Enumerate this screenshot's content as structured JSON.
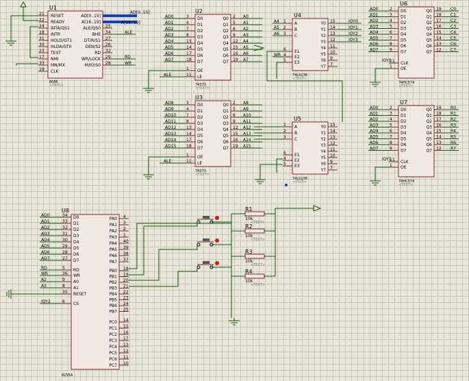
{
  "placeholder_text": "<TEXT>",
  "colors": {
    "wire": "#0a5a0a",
    "bus": "#1440c8",
    "chip": "#7a2a2a",
    "chip_fill": "#f1e7e3",
    "grid": "#c9c7b8"
  },
  "U1": {
    "ref": "U1",
    "type": "8086",
    "left_pins": [
      {
        "n": "21",
        "l": "RESET"
      },
      {
        "n": "22",
        "l": "READY"
      },
      {
        "n": "24",
        "l": "INTA/QS1"
      },
      {
        "n": "18",
        "l": "INTR"
      },
      {
        "n": "31",
        "l": "HOLD/GT1"
      },
      {
        "n": "30",
        "l": "HLDA/GT0"
      },
      {
        "n": "23",
        "l": "TEST"
      },
      {
        "n": "17",
        "l": "NMI"
      },
      {
        "n": "33",
        "l": "MN/MX"
      },
      {
        "n": "19",
        "l": "CLK"
      }
    ],
    "right_pins": [
      {
        "n": "",
        "l": "AD[0..15]"
      },
      {
        "n": "",
        "l": "A[16..19]"
      },
      {
        "n": "25",
        "l": "ALE/QS0"
      },
      {
        "n": "34",
        "l": "BHE"
      },
      {
        "n": "27",
        "l": "DT/R/S1"
      },
      {
        "n": "26",
        "l": "DEN/S2"
      },
      {
        "n": "32",
        "l": "RD"
      },
      {
        "n": "29",
        "l": "WR/LOCK"
      },
      {
        "n": "28",
        "l": "M/IO/S0"
      }
    ],
    "nets": [
      "AD[0..15]",
      "A[16..19]",
      "ALE",
      "RD",
      "WR"
    ]
  },
  "U2": {
    "ref": "U2",
    "type": "74373",
    "in_labels": [
      "D0",
      "D1",
      "D2",
      "D3",
      "D4",
      "D5",
      "D6",
      "D7"
    ],
    "in_pins": [
      "3",
      "4",
      "7",
      "8",
      "13",
      "14",
      "17",
      "18"
    ],
    "out_labels": [
      "Q0",
      "Q1",
      "Q2",
      "Q3",
      "Q4",
      "Q5",
      "Q6",
      "Q7"
    ],
    "out_pins": [
      "2",
      "5",
      "6",
      "9",
      "12",
      "15",
      "16",
      "19"
    ],
    "in_nets": [
      "AD0",
      "AD1",
      "AD2",
      "AD3",
      "AD4",
      "AD5",
      "AD6",
      "AD7"
    ],
    "out_nets": [
      "A0",
      "A1",
      "A2",
      "A3",
      "A4",
      "A5",
      "A6",
      "A7"
    ],
    "ctrl": [
      {
        "n": "1",
        "l": "OE"
      },
      {
        "n": "11",
        "l": "LE"
      }
    ],
    "le_net": "ALE"
  },
  "U3": {
    "ref": "U3",
    "type": "74373",
    "in_labels": [
      "D0",
      "D1",
      "D2",
      "D3",
      "D4",
      "D5",
      "D6",
      "D7"
    ],
    "in_pins": [
      "3",
      "4",
      "7",
      "8",
      "13",
      "14",
      "17",
      "18"
    ],
    "out_labels": [
      "Q0",
      "Q1",
      "Q2",
      "Q3",
      "Q4",
      "Q5",
      "Q6",
      "Q7"
    ],
    "out_pins": [
      "2",
      "5",
      "6",
      "9",
      "12",
      "15",
      "16",
      "19"
    ],
    "in_nets": [
      "AD8",
      "AD9",
      "AD10",
      "AD11",
      "AD12",
      "AD13",
      "AD14",
      "AD15"
    ],
    "out_nets": [
      "A8",
      "A9",
      "A10",
      "A11",
      "A12",
      "A13",
      "A14",
      "A15"
    ],
    "ctrl": [
      {
        "n": "1",
        "l": "OE"
      },
      {
        "n": "11",
        "l": "LE"
      }
    ],
    "le_net": "ALE"
  },
  "U4": {
    "ref": "U4",
    "type": "74LS138",
    "in_labels": [
      "A",
      "B",
      "C"
    ],
    "in_pins": [
      "1",
      "2",
      "3"
    ],
    "in_nets": [
      "A4",
      "A5",
      "A6"
    ],
    "en_labels": [
      "E1",
      "E2",
      "E3"
    ],
    "en_pins": [
      "6",
      "4",
      "5"
    ],
    "en_nets": [
      "",
      "WR",
      ""
    ],
    "out_labels": [
      "Y0",
      "Y1",
      "Y2",
      "Y3",
      "Y4",
      "Y5",
      "Y6",
      "Y7"
    ],
    "out_pins": [
      "15",
      "14",
      "13",
      "12",
      "11",
      "10",
      "9",
      "7"
    ],
    "out_nets": [
      "IOY0",
      "IOY1",
      "IOY2",
      "IOY3"
    ]
  },
  "U5": {
    "ref": "U5",
    "type": "74LS138",
    "in_labels": [
      "A",
      "B",
      "C"
    ],
    "in_pins": [
      "1",
      "2",
      "3"
    ],
    "in_nets": [
      "A12",
      "A13",
      "A14"
    ],
    "en_labels": [
      "E1",
      "E2",
      "E3"
    ],
    "en_pins": [
      "6",
      "4",
      "5"
    ],
    "out_labels": [
      "Y0",
      "Y1",
      "Y2",
      "Y3",
      "Y4",
      "Y5",
      "Y6",
      "Y7"
    ],
    "out_pins": [
      "15",
      "14",
      "13",
      "12",
      "11",
      "10",
      "9",
      "7"
    ]
  },
  "U6": {
    "ref": "U6",
    "type": "74HC574",
    "in_labels": [
      "D0",
      "D1",
      "D2",
      "D3",
      "D4",
      "D5",
      "D6",
      "D7"
    ],
    "in_pins": [
      "2",
      "3",
      "4",
      "5",
      "6",
      "7",
      "8",
      "9"
    ],
    "out_labels": [
      "Q0",
      "Q1",
      "Q2",
      "Q3",
      "Q4",
      "Q5",
      "Q6",
      "Q7"
    ],
    "out_pins": [
      "19",
      "18",
      "17",
      "16",
      "15",
      "14",
      "13",
      "12"
    ],
    "in_nets": [
      "AD0",
      "AD1",
      "AD2",
      "AD3",
      "AD4",
      "AD5",
      "AD6",
      "AD7"
    ],
    "out_nets": [
      "C0",
      "C1",
      "C2",
      "C3",
      "C4",
      "C5",
      "C6",
      "C7"
    ],
    "ctrl": [
      {
        "n": "11",
        "l": "CLK"
      },
      {
        "n": "1",
        "l": "OE"
      }
    ],
    "clk_net": "IOY0"
  },
  "U7": {
    "ref": "U7",
    "type": "74HC574",
    "in_labels": [
      "D0",
      "D1",
      "D2",
      "D3",
      "D4",
      "D5",
      "D6",
      "D7"
    ],
    "in_pins": [
      "2",
      "3",
      "4",
      "5",
      "6",
      "7",
      "8",
      "9"
    ],
    "out_labels": [
      "Q0",
      "Q1",
      "Q2",
      "Q3",
      "Q4",
      "Q5",
      "Q6",
      "Q7"
    ],
    "out_pins": [
      "19",
      "18",
      "17",
      "16",
      "15",
      "14",
      "13",
      "12"
    ],
    "in_nets": [
      "AD0",
      "AD1",
      "AD2",
      "AD3",
      "AD4",
      "AD5",
      "AD6",
      "AD7"
    ],
    "out_nets": [
      "R0",
      "R1",
      "R2",
      "R3",
      "R4",
      "R5",
      "R6",
      "R7"
    ],
    "ctrl": [
      {
        "n": "11",
        "l": "CLK"
      },
      {
        "n": "1",
        "l": "OE"
      }
    ],
    "clk_net": "IOY1"
  },
  "U8": {
    "ref": "U8",
    "type": "8255A",
    "d_labels": [
      "D0",
      "D1",
      "D2",
      "D3",
      "D4",
      "D5",
      "D6",
      "D7"
    ],
    "d_pins": [
      "34",
      "33",
      "32",
      "31",
      "30",
      "29",
      "28",
      "27"
    ],
    "d_nets": [
      "AD0",
      "AD1",
      "AD2",
      "AD3",
      "AD4",
      "AD5",
      "AD6",
      "AD7"
    ],
    "ctl_labels": [
      "RD",
      "WR",
      "A0",
      "A1",
      "RESET",
      "CS"
    ],
    "ctl_pins": [
      "5",
      "36",
      "9",
      "8",
      "35",
      "6"
    ],
    "ctl_nets": [
      "RD",
      "WR",
      "A2",
      "A3",
      "",
      "IOY2"
    ],
    "pa_labels": [
      "PA0",
      "PA1",
      "PA2",
      "PA3",
      "PA4",
      "PA5",
      "PA6",
      "PA7"
    ],
    "pa_pins": [
      "4",
      "3",
      "2",
      "1",
      "40",
      "39",
      "38",
      "37"
    ],
    "pb_labels": [
      "PB0",
      "PB1",
      "PB2",
      "PB3",
      "PB4",
      "PB5",
      "PB6",
      "PB7"
    ],
    "pb_pins": [
      "18",
      "19",
      "20",
      "21",
      "22",
      "23",
      "24",
      "25"
    ],
    "pc_labels": [
      "PC0",
      "PC1",
      "PC2",
      "PC3",
      "PC4",
      "PC5",
      "PC6",
      "PC7"
    ],
    "pc_pins": [
      "14",
      "15",
      "16",
      "17",
      "13",
      "12",
      "11",
      "10"
    ]
  },
  "resistors": [
    {
      "ref": "R1",
      "value": "10k"
    },
    {
      "ref": "R2",
      "value": "10k"
    },
    {
      "ref": "R3",
      "value": "10k"
    },
    {
      "ref": "R4",
      "value": "10k"
    }
  ]
}
